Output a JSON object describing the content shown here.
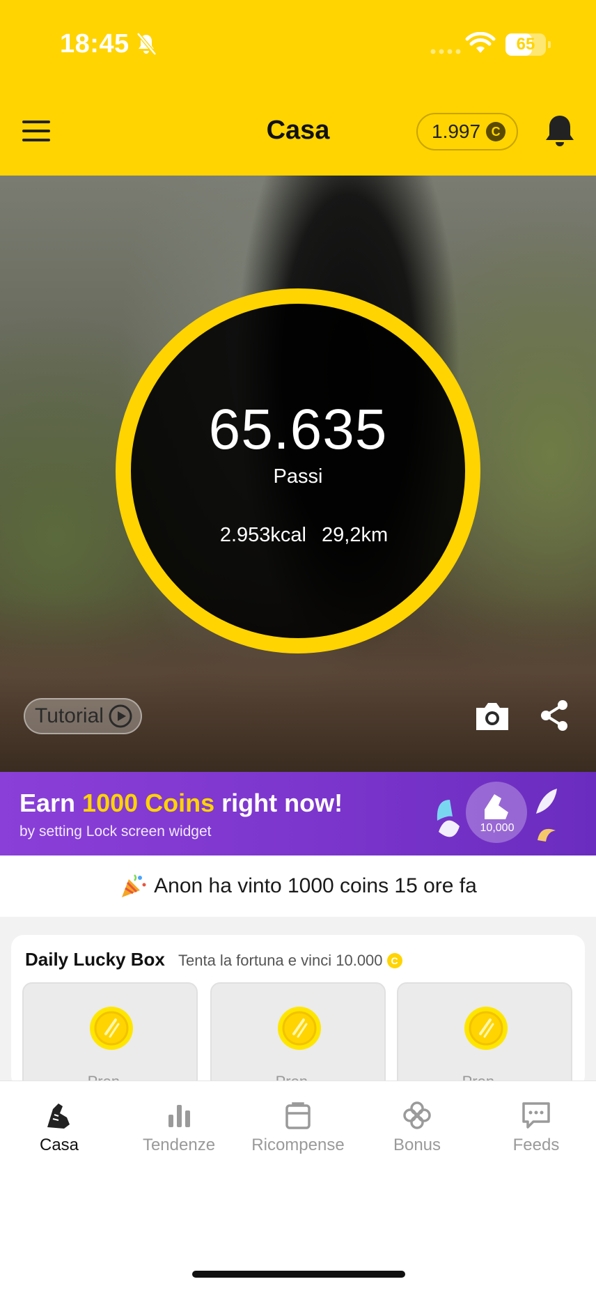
{
  "status_bar": {
    "time": "18:45",
    "battery": "65",
    "battery_level": 0.65
  },
  "header": {
    "title": "Casa",
    "coin_balance": "1.997",
    "coin_symbol": "C"
  },
  "hero": {
    "steps": "65.635",
    "steps_label": "Passi",
    "kcal": "2.953kcal",
    "distance": "29,2km",
    "tutorial_label": "Tutorial"
  },
  "promo": {
    "title_prefix": "Earn ",
    "title_highlight": "1000 Coins",
    "title_suffix": " right now!",
    "subtitle": "by setting Lock screen widget",
    "badge_value": "10,000"
  },
  "ticker": {
    "text": "Anon ha vinto 1000 coins 15 ore fa"
  },
  "lucky_box": {
    "title": "Daily Lucky Box",
    "subtitle": "Tenta la fortuna e vinci 10.000",
    "coin_symbol": "C",
    "boxes": [
      {
        "label": "Pren..."
      },
      {
        "label": "Pren..."
      },
      {
        "label": "Pren..."
      }
    ]
  },
  "tabs": [
    {
      "label": "Casa",
      "icon": "shoe-icon",
      "active": true
    },
    {
      "label": "Tendenze",
      "icon": "bar-chart-icon",
      "active": false
    },
    {
      "label": "Ricompense",
      "icon": "clipboard-icon",
      "active": false
    },
    {
      "label": "Bonus",
      "icon": "clover-icon",
      "active": false
    },
    {
      "label": "Feeds",
      "icon": "chat-icon",
      "active": false
    }
  ],
  "colors": {
    "brand_yellow": "#FFD400",
    "promo_purple": "#7b35cc"
  }
}
